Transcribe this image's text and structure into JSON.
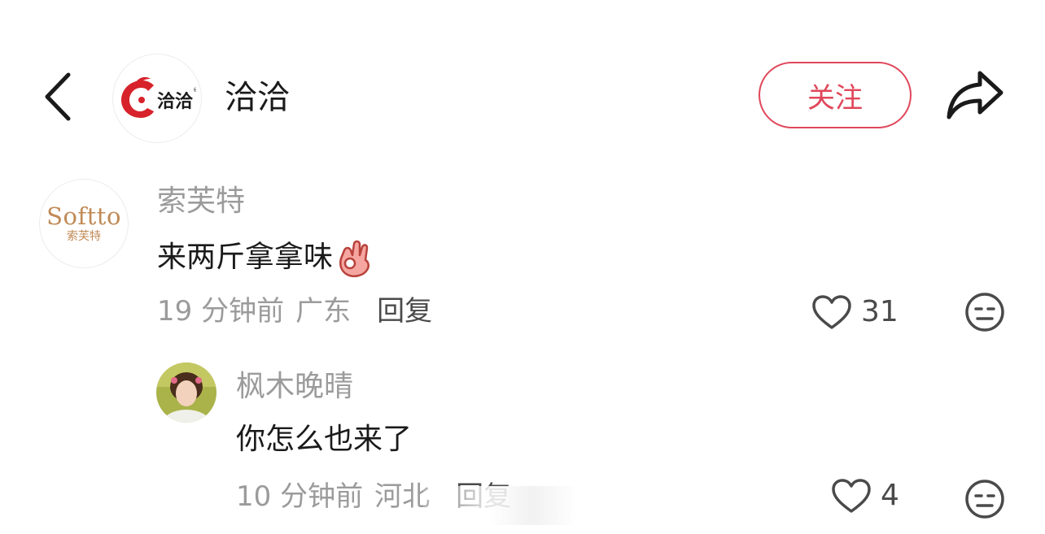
{
  "header": {
    "account_name": "洽洽",
    "logo_text": "洽洽",
    "follow_label": "关注"
  },
  "comments": [
    {
      "username": "索芙特",
      "avatar_logo": {
        "word": "Softto",
        "cn": "索芙特"
      },
      "text": "来两斤拿拿味",
      "emoji": "ok-hand-emoji",
      "time": "19 分钟前",
      "location": "广东",
      "reply_label": "回复",
      "likes": "31"
    },
    {
      "username": "枫木晚晴",
      "text": "你怎么也来了",
      "time": "10 分钟前",
      "location": "河北",
      "reply_label": "回复",
      "likes": "4"
    }
  ],
  "colors": {
    "accent": "#e0475b",
    "meta_gray": "#9b9b9b",
    "text": "#1a1a1a",
    "brand_red": "#d7222b",
    "softto_gold": "#c08a55"
  }
}
